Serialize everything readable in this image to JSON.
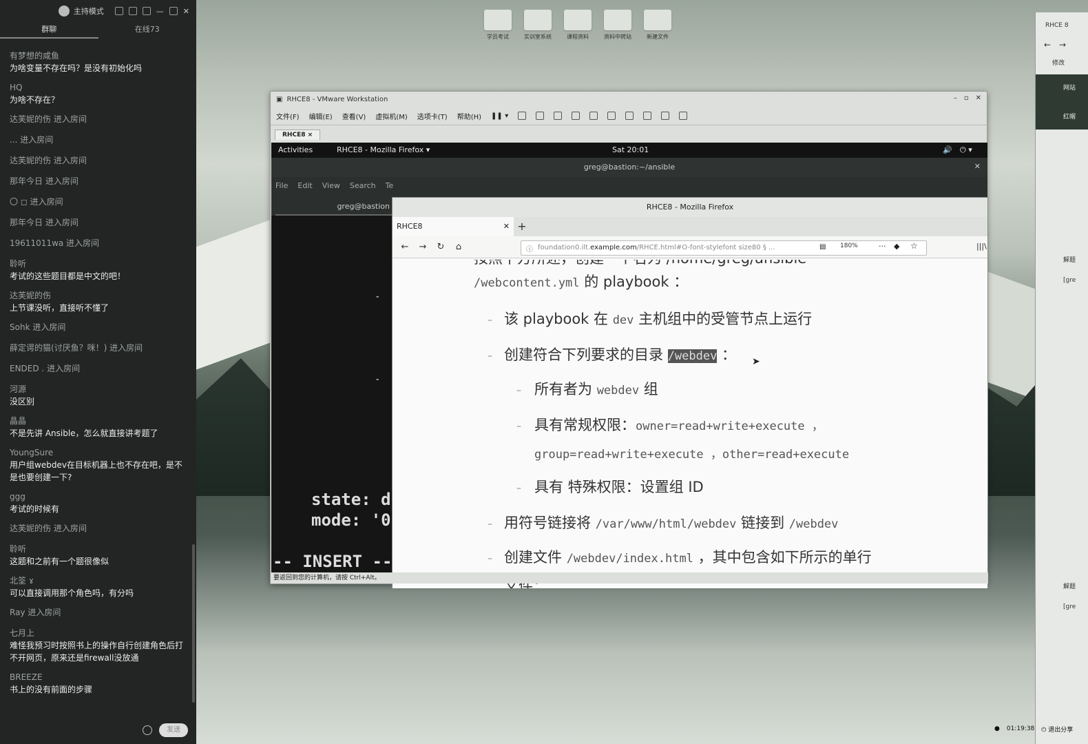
{
  "chat_panel": {
    "mode_label": "主持模式",
    "tabs": [
      "群聊",
      "在线73"
    ],
    "messages": [
      {
        "type": "msg",
        "nick": "有梦想的咸鱼",
        "text": "为啥变量不存在吗？是没有初始化吗"
      },
      {
        "type": "msg",
        "nick": "HQ",
        "text": "为啥不存在？"
      },
      {
        "type": "sys",
        "text": "达芙妮的伤 进入房间"
      },
      {
        "type": "sys",
        "text": "... 进入房间"
      },
      {
        "type": "sys",
        "text": "达芙妮的伤 进入房间"
      },
      {
        "type": "sys",
        "text": "那年今日 进入房间"
      },
      {
        "type": "sys",
        "text": "〇 ◻ 进入房间"
      },
      {
        "type": "sys",
        "text": "那年今日 进入房间"
      },
      {
        "type": "sys",
        "text": "19611011wa 进入房间"
      },
      {
        "type": "msg",
        "nick": "聆听",
        "text": "考试的这些题目都是中文的吧！"
      },
      {
        "type": "msg",
        "nick": "达芙妮的伤",
        "text": "上节课没听，直接听不懂了"
      },
      {
        "type": "sys",
        "text": "Sohk 进入房间"
      },
      {
        "type": "sys",
        "text": "薛定谔的猫(讨厌鱼？咪！) 进入房间"
      },
      {
        "type": "sys",
        "text": "ENDED . 进入房间"
      },
      {
        "type": "msg",
        "nick": "河源",
        "text": "没区别"
      },
      {
        "type": "msg",
        "nick": "晶晶",
        "text": "不是先讲 Ansible，怎么就直接讲考题了"
      },
      {
        "type": "msg",
        "nick": "YoungSure",
        "text": "用户组webdev在目标机器上也不存在吧，是不是也要创建一下?"
      },
      {
        "type": "msg",
        "nick": "ggg",
        "text": "考试的时候有"
      },
      {
        "type": "sys",
        "text": "达芙妮的伤 进入房间"
      },
      {
        "type": "msg",
        "nick": "聆听",
        "text": "这题和之前有一个题很像似"
      },
      {
        "type": "msg",
        "nick": "北筌 ɤ",
        "text": "可以直接调用那个角色吗，有分吗"
      },
      {
        "type": "sys",
        "text": "Ray 进入房间"
      },
      {
        "type": "msg",
        "nick": "七月上",
        "text": "难怪我预习时按照书上的操作自行创建角色后打不开网页，原来还是firewall没放通"
      },
      {
        "type": "msg",
        "nick": "BREEZE",
        "text": "书上的没有前面的步骤"
      }
    ]
  },
  "desktop_icons": [
    "学员考试",
    "实训室系统",
    "课程资料",
    "资料中转站",
    "新建文件"
  ],
  "right_window": {
    "title": "RHCE 8",
    "back_label": "修改",
    "site_label": "网站",
    "tab_label": "红帽",
    "label_a": "解题",
    "label_b": "解题",
    "code_a": "[gre",
    "code_b": "[gre"
  },
  "vmware": {
    "title": "RHCE8 - VMware Workstation",
    "menu": [
      "文件(F)",
      "编辑(E)",
      "查看(V)",
      "虚拟机(M)",
      "选项卡(T)",
      "帮助(H)"
    ],
    "tab": "RHCE8",
    "status": "要返回到您的计算机，请按 Ctrl+Alt。"
  },
  "gnome": {
    "activities": "Activities",
    "app": "RHCE8 - Mozilla Firefox ▾",
    "clock": "Sat 20:01"
  },
  "terminal": {
    "title": "greg@bastion:~/ansible",
    "menu": [
      "File",
      "Edit",
      "View",
      "Search",
      "Te"
    ],
    "tab": "greg@bastion",
    "lines": [
      "state: d",
      "mode: '0"
    ],
    "mode_line": "-- INSERT --"
  },
  "firefox": {
    "title": "RHCE8 - Mozilla Firefox",
    "tab": "RHCE8",
    "url_prefix": "foundation0.ilt.",
    "url_domain": "example.com",
    "url_suffix": "/RHCE.html#O-font-stylefont size80 § ...",
    "zoom": "180%",
    "doc": {
      "line0": "按照下方所述，创建一个名为 /home/greg/ansible",
      "line1_mono": "/webcontent.yml",
      "line1_zh": " 的 playbook ：",
      "b1_a": "该 playbook 在 ",
      "b1_mono": "dev",
      "b1_b": " 主机组中的受管节点上运行",
      "b2_a": "创建符合下列要求的目录 ",
      "b2_mono": "/webdev",
      "b2_b": " ：",
      "s1_a": "所有者为 ",
      "s1_mono": "webdev",
      "s1_b": " 组",
      "s2_a": "具有常规权限：",
      "s2_mono": "owner=read+write+execute ，",
      "s2_line2": "group=read+write+execute ，other=read+execute",
      "s3": "具有 特殊权限：设置组 ID",
      "b3_a": "用符号链接将 ",
      "b3_mono": "/var/www/html/webdev",
      "b3_b": " 链接到 ",
      "b3_mono2": "/webdev",
      "b4_a": "创建文件 ",
      "b4_mono": "/webdev/index.html",
      "b4_b": " ，其中包含如下所示的单行",
      "b4_line2": "文件："
    }
  },
  "live": {
    "timer": "01:19:38",
    "exit": "退出分享"
  }
}
